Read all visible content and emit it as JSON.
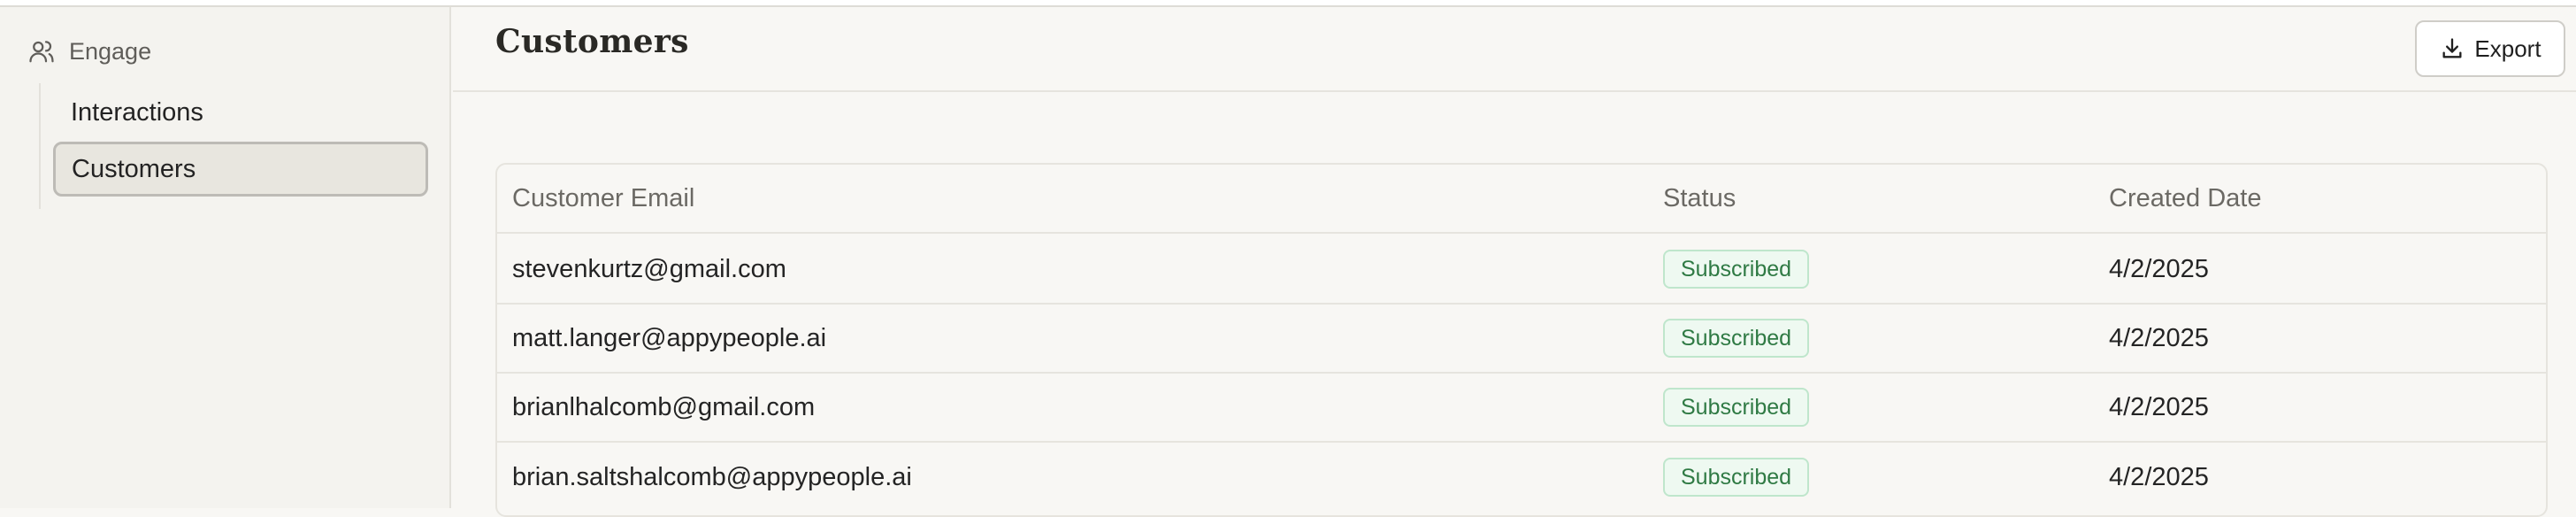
{
  "sidebar": {
    "section_icon": "users-icon",
    "section_label": "Engage",
    "items": [
      {
        "label": "Interactions",
        "active": false
      },
      {
        "label": "Customers",
        "active": true
      }
    ]
  },
  "header": {
    "title": "Customers",
    "export_label": "Export",
    "export_icon": "download-icon"
  },
  "table": {
    "columns": [
      "Customer Email",
      "Status",
      "Created Date"
    ],
    "rows": [
      {
        "email": "stevenkurtz@gmail.com",
        "status": "Subscribed",
        "created": "4/2/2025"
      },
      {
        "email": "matt.langer@appypeople.ai",
        "status": "Subscribed",
        "created": "4/2/2025"
      },
      {
        "email": "brianlhalcomb@gmail.com",
        "status": "Subscribed",
        "created": "4/2/2025"
      },
      {
        "email": "brian.saltshalcomb@appypeople.ai",
        "status": "Subscribed",
        "created": "4/2/2025"
      }
    ]
  },
  "colors": {
    "background": "#f8f7f4",
    "sidebar_bg": "#f4f3ef",
    "active_item_bg": "#e8e6df",
    "badge_text": "#2f7a44",
    "badge_bg": "#eef9f1",
    "badge_border": "#bfe6cc"
  }
}
